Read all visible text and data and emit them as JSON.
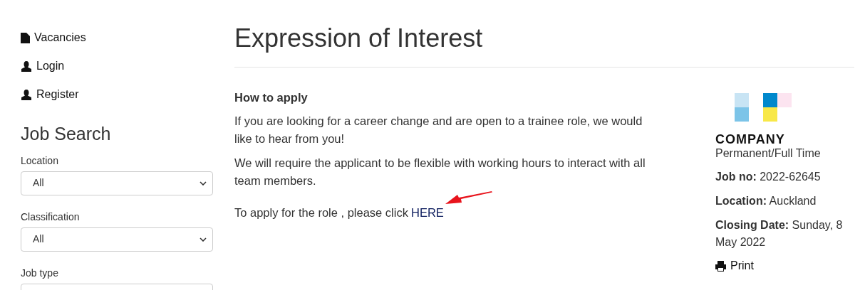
{
  "nav": [
    {
      "kind": "document",
      "label": "Vacancies"
    },
    {
      "kind": "person",
      "label": "Login"
    },
    {
      "kind": "person",
      "label": "Register"
    }
  ],
  "job_search": {
    "title": "Job Search",
    "filters": [
      {
        "label": "Location",
        "value": "All"
      },
      {
        "label": "Classification",
        "value": "All"
      },
      {
        "label": "Job type"
      }
    ]
  },
  "page_title": "Expression of Interest",
  "content": {
    "heading": "How to apply",
    "paragraphs": [
      "If you are looking for a career change and are open to a trainee role, we would like to hear from you!",
      "We will require the applicant to be flexible with working hours to interact with all team members."
    ],
    "apply_text": "To apply for the role , please click",
    "apply_link": "HERE"
  },
  "job": {
    "company": "COMPANY",
    "employment_type": "Permanent/Full Time",
    "details": [
      {
        "label": "Job no:",
        "value": "2022-62645"
      },
      {
        "label": "Location:",
        "value": "Auckland"
      },
      {
        "label": "Closing Date:",
        "value": "Sunday, 8 May 2022"
      }
    ],
    "print": "Print"
  }
}
